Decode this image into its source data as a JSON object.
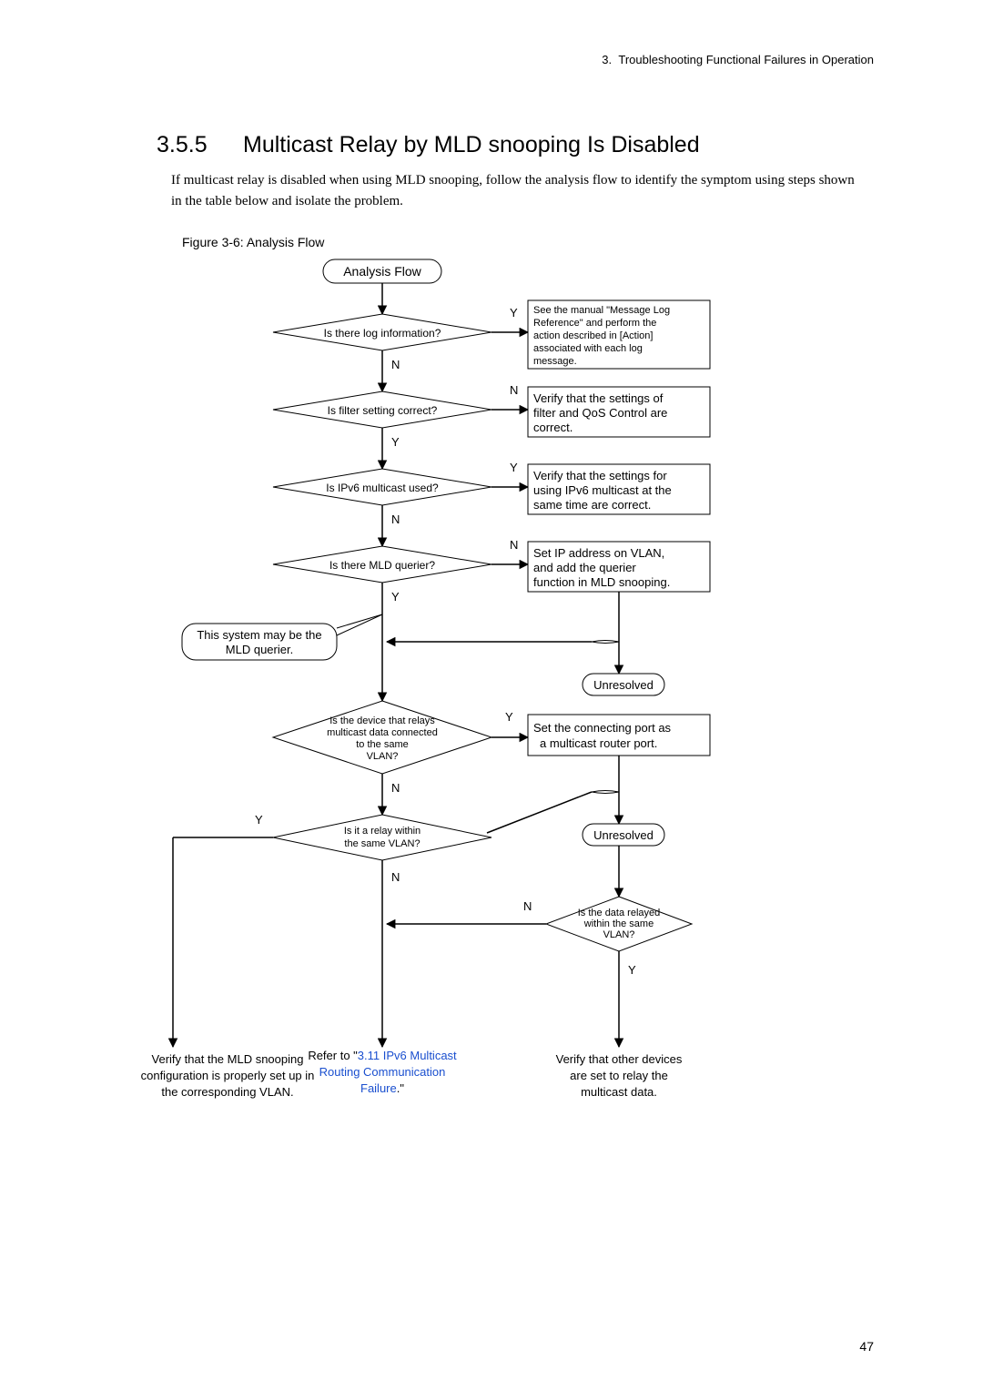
{
  "header": {
    "chapter_num": "3.",
    "chapter_title": "Troubleshooting Functional Failures in Operation"
  },
  "section": {
    "number": "3.5.5",
    "title": "Multicast Relay by MLD snooping Is Disabled"
  },
  "intro": "If multicast relay is disabled when using MLD snooping, follow the analysis flow to identify the symptom using steps shown in the table below and isolate the problem.",
  "figure_caption": "Figure 3-6: Analysis Flow",
  "flow": {
    "start": "Analysis Flow",
    "d1": "Is there log information?",
    "b1_l1": "See the manual \"Message Log",
    "b1_l2": "Reference\" and perform the",
    "b1_l3": "action described in [Action]",
    "b1_l4": "associated with each log",
    "b1_l5": "message.",
    "d2": "Is filter setting correct?",
    "b2_l1": "Verify that the settings of",
    "b2_l2": "filter and QoS Control are",
    "b2_l3": "correct.",
    "d3": "Is IPv6 multicast used?",
    "b3_l1": "Verify that the settings for",
    "b3_l2": "using IPv6 multicast at the",
    "b3_l3": "same time are correct.",
    "d4": "Is there MLD querier?",
    "b4_l1": "Set IP address on VLAN,",
    "b4_l2": "and add the querier",
    "b4_l3": "function in MLD snooping.",
    "aside_l1": "This system may be the",
    "aside_l2": "MLD querier.",
    "unresolved": "Unresolved",
    "d5_l1": "Is the device that relays",
    "d5_l2": "multicast data connected",
    "d5_l3": "to the same",
    "d5_l4": "VLAN?",
    "b5_l1": "Set the connecting port as",
    "b5_l2": "a multicast router port.",
    "d6_l1": "Is it a relay within",
    "d6_l2": "the same VLAN?",
    "d7_l1": "Is the data relayed",
    "d7_l2": "within the same",
    "d7_l3": "VLAN?",
    "end_left_l1": "Verify that the MLD snooping",
    "end_left_l2": "configuration is properly set up in",
    "end_left_l3": "the corresponding VLAN.",
    "end_mid_pre": "Refer to \"",
    "end_mid_link1": "3.11 IPv6 Multicast",
    "end_mid_link2": "Routing Communication",
    "end_mid_link3": "Failure",
    "end_mid_post": ".\"",
    "end_right_l1": "Verify that other devices",
    "end_right_l2": "are set to relay the",
    "end_right_l3": "multicast data.",
    "Y": "Y",
    "N": "N"
  },
  "page_number": "47"
}
